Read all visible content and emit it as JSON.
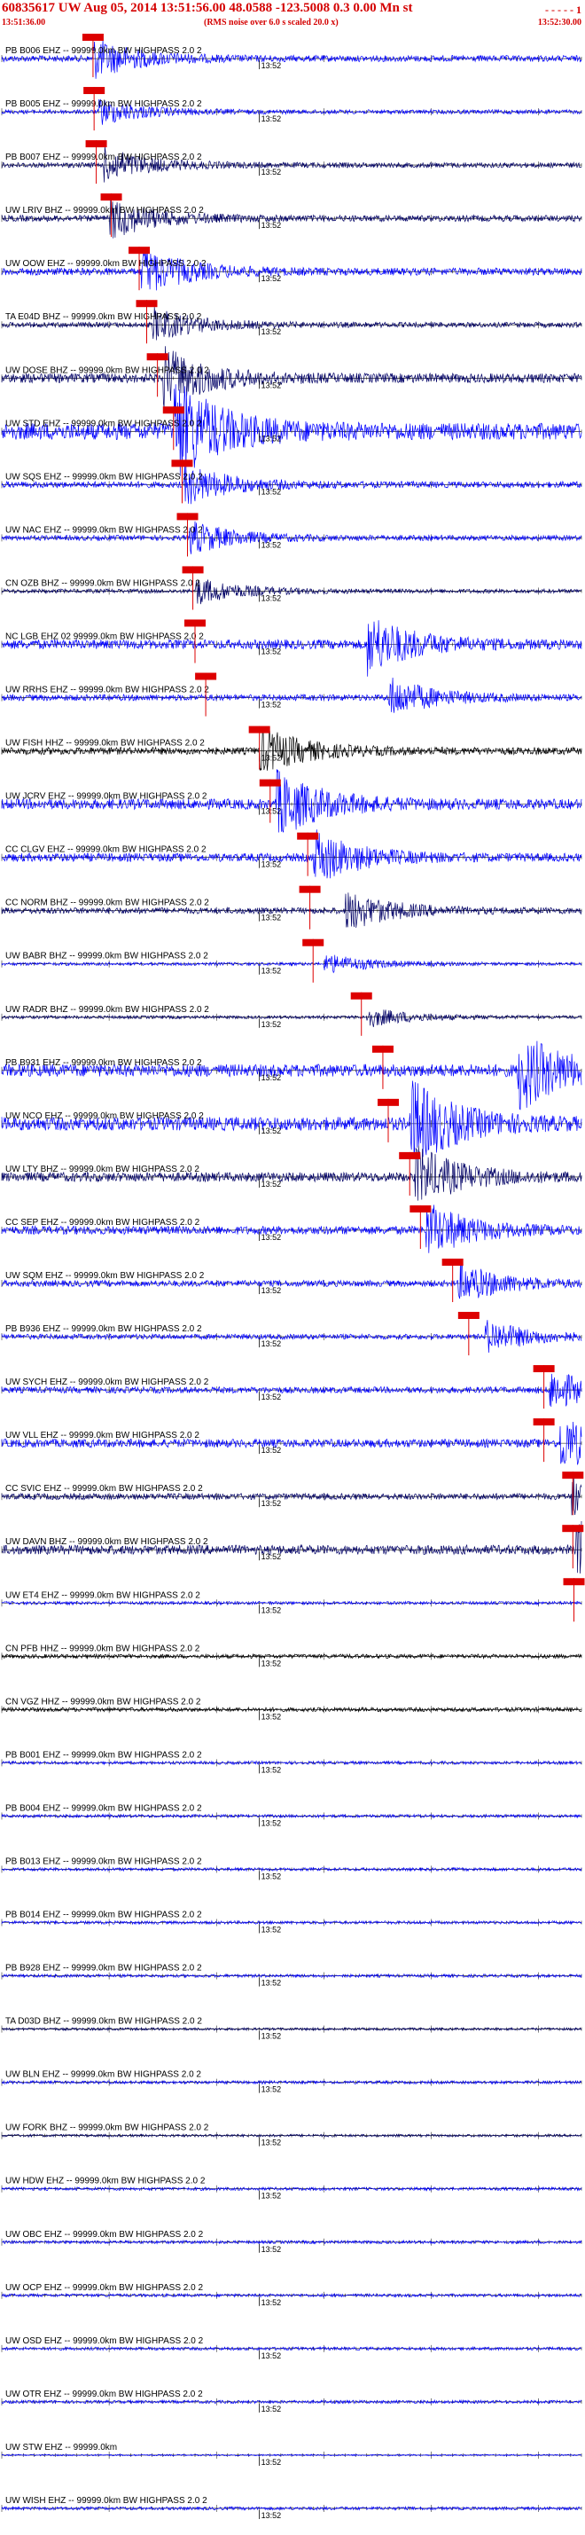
{
  "header": {
    "title": "60835617 UW Aug 05, 2014 13:51:56.00   48.0588 -123.5008  0.3 0.00 Mn st",
    "title_right": "- - - - - 1",
    "subtitle": "(RMS noise over 6.0 s scaled 20.0 x)",
    "time_left": "13:51:36.00",
    "time_right": "13:52:30.00"
  },
  "chart_data": {
    "type": "line",
    "title": "60835617 UW Aug 05, 2014 13:51:56.00   48.0588 -123.5008  0.3 0.00 Mn st",
    "x_range": [
      "13:51:36.00",
      "13:52:30.00"
    ],
    "x_duration_s": 54,
    "tick_mark_label": "13:52",
    "tick_mark_offset_s": 24,
    "colors": {
      "trace_blue": "#0000ff",
      "trace_dark": "#000066",
      "trace_black": "#000000",
      "pick_red": "#dd0000",
      "axis": "#000000"
    },
    "traces": [
      {
        "label": "PB B006 EHZ -- 99999.0km BW  HIGHPASS  2.0  2",
        "pick_s": 8.5,
        "color": "#0000ff",
        "amp": 0.6,
        "event_s": 8.5
      },
      {
        "label": "PB B005 EHZ -- 99999.0km BW  HIGHPASS  2.0  2",
        "pick_s": 8.6,
        "color": "#0000ff",
        "amp": 0.4,
        "event_s": 9
      },
      {
        "label": "PB B007 EHZ -- 99999.0km BW  HIGHPASS  2.0  2",
        "pick_s": 8.8,
        "color": "#000066",
        "amp": 0.5,
        "event_s": 9.5
      },
      {
        "label": "UW LRIV BHZ -- 99999.0km BW  HIGHPASS  2.0  2",
        "pick_s": 10.2,
        "color": "#000066",
        "amp": 0.6,
        "event_s": 10
      },
      {
        "label": "UW OOW EHZ -- 99999.0km BW  HIGHPASS  2.0  2",
        "pick_s": 12.8,
        "color": "#0000ff",
        "amp": 0.7,
        "event_s": 13
      },
      {
        "label": "TA E04D BHZ -- 99999.0km BW  HIGHPASS  2.0  2",
        "pick_s": 13.5,
        "color": "#000066",
        "amp": 0.5,
        "event_s": 14
      },
      {
        "label": "UW DOSE BHZ -- 99999.0km BW  HIGHPASS  2.0  2",
        "pick_s": 14.5,
        "color": "#000066",
        "amp": 0.9,
        "event_s": 15
      },
      {
        "label": "UW STD EHZ -- 99999.0km BW  HIGHPASS  2.0  2",
        "pick_s": 16.0,
        "color": "#0000ff",
        "amp": 1.6,
        "event_s": 16
      },
      {
        "label": "UW SQS EHZ -- 99999.0km BW  HIGHPASS  2.0  2",
        "pick_s": 16.8,
        "color": "#0000ff",
        "amp": 0.6,
        "event_s": 17
      },
      {
        "label": "UW NAC EHZ -- 99999.0km BW  HIGHPASS  2.0  2",
        "pick_s": 17.3,
        "color": "#0000ff",
        "amp": 0.5,
        "event_s": 17.5
      },
      {
        "label": "CN OZB BHZ -- 99999.0km BW  HIGHPASS  2.0  2",
        "pick_s": 17.8,
        "color": "#000066",
        "amp": 0.4,
        "event_s": 18
      },
      {
        "label": "NC LGB EHZ 02 99999.0km BW  HIGHPASS  2.0  2",
        "pick_s": 18.0,
        "color": "#0000ff",
        "amp": 0.9,
        "event_s": 34
      },
      {
        "label": "UW RRHS EHZ -- 99999.0km BW  HIGHPASS  2.0  2",
        "pick_s": 19.0,
        "color": "#0000ff",
        "amp": 0.6,
        "event_s": 36
      },
      {
        "label": "UW FISH HHZ -- 99999.0km BW  HIGHPASS  2.0  2",
        "pick_s": 24.0,
        "color": "#000000",
        "amp": 0.7,
        "event_s": 24
      },
      {
        "label": "UW JCRV EHZ -- 99999.0km BW  HIGHPASS  2.0  2",
        "pick_s": 25.0,
        "color": "#0000ff",
        "amp": 1.0,
        "event_s": 25.5
      },
      {
        "label": "CC CLGV EHZ -- 99999.0km BW  HIGHPASS  2.0  2",
        "pick_s": 28.5,
        "color": "#0000ff",
        "amp": 0.8,
        "event_s": 29
      },
      {
        "label": "CC NORM BHZ -- 99999.0km BW  HIGHPASS  2.0  2",
        "pick_s": 28.7,
        "color": "#000066",
        "amp": 0.6,
        "event_s": 32
      },
      {
        "label": "UW BABR BHZ -- 99999.0km BW  HIGHPASS  2.0  2",
        "pick_s": 29.0,
        "color": "#0000ff",
        "amp": 0.3,
        "event_s": 30
      },
      {
        "label": "UW RADR BHZ -- 99999.0km BW  HIGHPASS  2.0  2",
        "pick_s": 33.5,
        "color": "#000066",
        "amp": 0.3,
        "event_s": 34
      },
      {
        "label": "PB B931 EHZ -- 99999.0km BW  HIGHPASS  2.0  2",
        "pick_s": 35.5,
        "color": "#0000ff",
        "amp": 1.2,
        "event_s": 48
      },
      {
        "label": "UW NCO EHZ -- 99999.0km BW  HIGHPASS  2.0  2",
        "pick_s": 36.0,
        "color": "#0000ff",
        "amp": 1.3,
        "event_s": 38
      },
      {
        "label": "UW LTY BHZ -- 99999.0km BW  HIGHPASS  2.0  2",
        "pick_s": 38.0,
        "color": "#000066",
        "amp": 0.9,
        "event_s": 38.5
      },
      {
        "label": "CC SEP EHZ -- 99999.0km BW  HIGHPASS  2.0  2",
        "pick_s": 39.0,
        "color": "#0000ff",
        "amp": 0.8,
        "event_s": 39.5
      },
      {
        "label": "UW SQM EHZ -- 99999.0km BW  HIGHPASS  2.0  2",
        "pick_s": 42.0,
        "color": "#0000ff",
        "amp": 0.6,
        "event_s": 42.5
      },
      {
        "label": "PB B936 EHZ -- 99999.0km BW  HIGHPASS  2.0  2",
        "pick_s": 43.5,
        "color": "#0000ff",
        "amp": 0.5,
        "event_s": 45
      },
      {
        "label": "UW SYCH EHZ -- 99999.0km BW  HIGHPASS  2.0  2",
        "pick_s": 50.5,
        "color": "#0000ff",
        "amp": 0.6,
        "event_s": 51
      },
      {
        "label": "UW VLL EHZ -- 99999.0km BW  HIGHPASS  2.0  2",
        "pick_s": 50.5,
        "color": "#0000ff",
        "amp": 0.8,
        "event_s": 52
      },
      {
        "label": "CC SVIC EHZ -- 99999.0km BW  HIGHPASS  2.0  2",
        "pick_s": 53.2,
        "color": "#000066",
        "amp": 0.6,
        "event_s": 53
      },
      {
        "label": "UW DAVN BHZ -- 99999.0km BW  HIGHPASS  2.0  2",
        "pick_s": 53.2,
        "color": "#000066",
        "amp": 0.9,
        "event_s": 53.5
      },
      {
        "label": "UW ET4 EHZ -- 99999.0km BW  HIGHPASS  2.0  2",
        "pick_s": 53.3,
        "color": "#0000ff",
        "amp": 0.3,
        "event_s": 0
      },
      {
        "label": "CN PFB HHZ -- 99999.0km BW  HIGHPASS  2.0  2",
        "pick_s": null,
        "color": "#000000",
        "amp": 0.4,
        "event_s": 0
      },
      {
        "label": "CN VGZ HHZ -- 99999.0km BW  HIGHPASS  2.0  2",
        "pick_s": null,
        "color": "#000000",
        "amp": 0.4,
        "event_s": 0
      },
      {
        "label": "PB B001 EHZ -- 99999.0km BW  HIGHPASS  2.0  2",
        "pick_s": null,
        "color": "#0000ff",
        "amp": 0.3,
        "event_s": 0
      },
      {
        "label": "PB B004 EHZ -- 99999.0km BW  HIGHPASS  2.0  2",
        "pick_s": null,
        "color": "#0000ff",
        "amp": 0.3,
        "event_s": 0
      },
      {
        "label": "PB B013 EHZ -- 99999.0km BW  HIGHPASS  2.0  2",
        "pick_s": null,
        "color": "#0000ff",
        "amp": 0.3,
        "event_s": 0
      },
      {
        "label": "PB B014 EHZ -- 99999.0km BW  HIGHPASS  2.0  2",
        "pick_s": null,
        "color": "#0000ff",
        "amp": 0.3,
        "event_s": 0
      },
      {
        "label": "PB B928 EHZ -- 99999.0km BW  HIGHPASS  2.0  2",
        "pick_s": null,
        "color": "#0000ff",
        "amp": 0.3,
        "event_s": 0
      },
      {
        "label": "TA D03D BHZ -- 99999.0km BW  HIGHPASS  2.0  2",
        "pick_s": null,
        "color": "#000066",
        "amp": 0.25,
        "event_s": 0
      },
      {
        "label": "UW BLN EHZ -- 99999.0km BW  HIGHPASS  2.0  2",
        "pick_s": null,
        "color": "#0000ff",
        "amp": 0.3,
        "event_s": 0
      },
      {
        "label": "UW FORK BHZ -- 99999.0km BW  HIGHPASS  2.0  2",
        "pick_s": null,
        "color": "#000066",
        "amp": 0.25,
        "event_s": 0
      },
      {
        "label": "UW HDW EHZ -- 99999.0km BW  HIGHPASS  2.0  2",
        "pick_s": null,
        "color": "#0000ff",
        "amp": 0.3,
        "event_s": 0
      },
      {
        "label": "UW OBC EHZ -- 99999.0km BW  HIGHPASS  2.0  2",
        "pick_s": null,
        "color": "#0000ff",
        "amp": 0.3,
        "event_s": 0
      },
      {
        "label": "UW OCP EHZ -- 99999.0km BW  HIGHPASS  2.0  2",
        "pick_s": null,
        "color": "#0000ff",
        "amp": 0.3,
        "event_s": 0
      },
      {
        "label": "UW OSD EHZ -- 99999.0km BW  HIGHPASS  2.0  2",
        "pick_s": null,
        "color": "#0000ff",
        "amp": 0.3,
        "event_s": 0
      },
      {
        "label": "UW OTR EHZ -- 99999.0km BW  HIGHPASS  2.0  2",
        "pick_s": null,
        "color": "#0000ff",
        "amp": 0.3,
        "event_s": 0
      },
      {
        "label": "UW STW EHZ -- 99999.0km",
        "pick_s": null,
        "color": "#0000ff",
        "amp": 0.15,
        "event_s": 0
      },
      {
        "label": "UW WISH EHZ -- 99999.0km BW  HIGHPASS  2.0  2",
        "pick_s": null,
        "color": "#0000ff",
        "amp": 0.3,
        "event_s": 0
      }
    ]
  }
}
